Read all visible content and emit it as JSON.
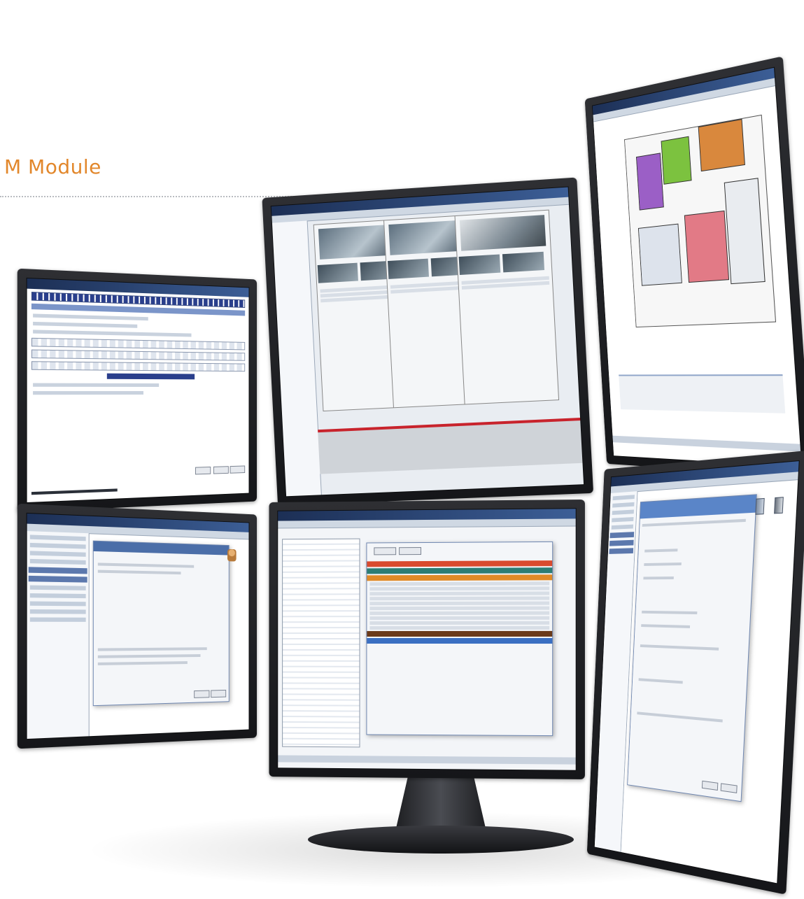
{
  "heading": {
    "title": "M Module"
  },
  "monitors": {
    "top_left": {
      "title": ""
    },
    "top_center": {
      "title": ""
    },
    "top_right": {
      "title": ""
    },
    "bottom_left": {
      "title": ""
    },
    "bottom_center": {
      "title": ""
    },
    "bottom_right": {
      "title": ""
    }
  },
  "colors": {
    "heading_accent": "#e2872b",
    "titlebar": "#1c2f55",
    "alarm_red": "#d94a2e",
    "alarm_teal": "#2c7d74",
    "alarm_orange": "#e08a27",
    "timeline_red": "#c8232c",
    "floor_purple": "#9b5fc6",
    "floor_green": "#7cc23f",
    "floor_orange": "#d9883d",
    "floor_pink": "#e27a86"
  },
  "icons": [
    "camera-tile",
    "floorplan",
    "alarm-bar",
    "monitor-stand"
  ]
}
